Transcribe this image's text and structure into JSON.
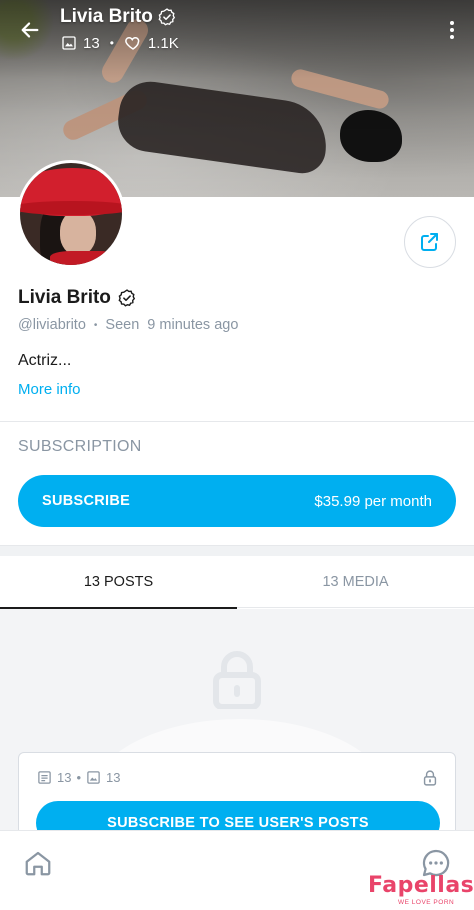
{
  "header": {
    "name": "Livia Brito",
    "photos_count": "13",
    "likes_count": "1.1K"
  },
  "profile": {
    "name": "Livia Brito",
    "username": "@liviabrito",
    "seen_label": "Seen",
    "seen_time": "9 minutes ago",
    "bio": "Actriz...",
    "more_info_label": "More info"
  },
  "subscription": {
    "heading": "SUBSCRIPTION",
    "button_label": "SUBSCRIBE",
    "price_label": "$35.99 per month"
  },
  "tabs": [
    {
      "label": "13 POSTS",
      "active": true
    },
    {
      "label": "13 MEDIA",
      "active": false
    }
  ],
  "locked": {
    "posts_count": "13",
    "media_count": "13",
    "button_label": "SUBSCRIBE TO SEE USER'S POSTS"
  },
  "watermark": {
    "brand": "Fapellas",
    "tagline": "WE LOVE PORN"
  },
  "colors": {
    "accent": "#00aff0",
    "muted": "#8a96a3",
    "watermark": "#e9446a"
  },
  "icons": {
    "back": "arrow-left-icon",
    "verified": "verified-badge-icon",
    "photos": "image-icon",
    "likes": "heart-icon",
    "menu": "more-vertical-icon",
    "share": "share-icon",
    "lock": "lock-icon",
    "posts": "document-icon",
    "home": "home-icon",
    "chat": "chat-bubble-icon"
  }
}
